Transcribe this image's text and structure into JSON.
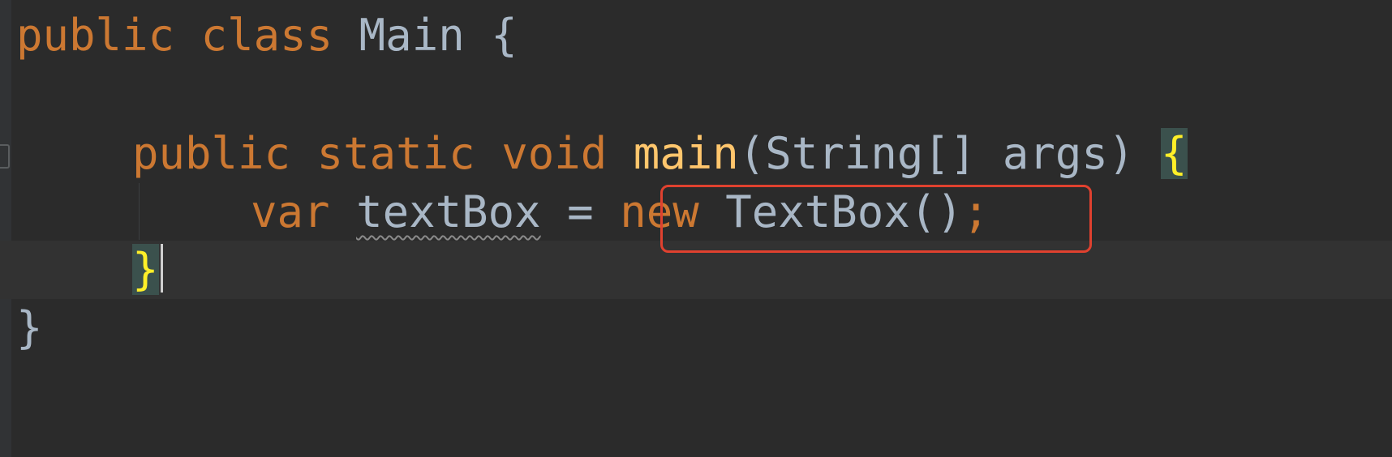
{
  "code": {
    "line1": {
      "kw_public": "public",
      "kw_class": "class",
      "class_name": "Main",
      "open_brace": "{"
    },
    "line2": {
      "kw_public": "public",
      "kw_static": "static",
      "kw_void": "void",
      "method_name": "main",
      "params": "(String[] args)",
      "open_brace": "{"
    },
    "line3": {
      "kw_var": "var",
      "var_name": "textBox",
      "assign": "=",
      "kw_new": "new",
      "expr": "TextBox()",
      "semicolon": ";"
    },
    "line4": {
      "close_brace": "}"
    },
    "line5": {
      "close_brace": "}"
    }
  },
  "colors": {
    "background": "#2b2b2b",
    "keyword": "#cc7832",
    "method": "#ffc66d",
    "text": "#a9b7c6",
    "brace_match": "#ffef28",
    "highlight_box": "#e0412f"
  }
}
